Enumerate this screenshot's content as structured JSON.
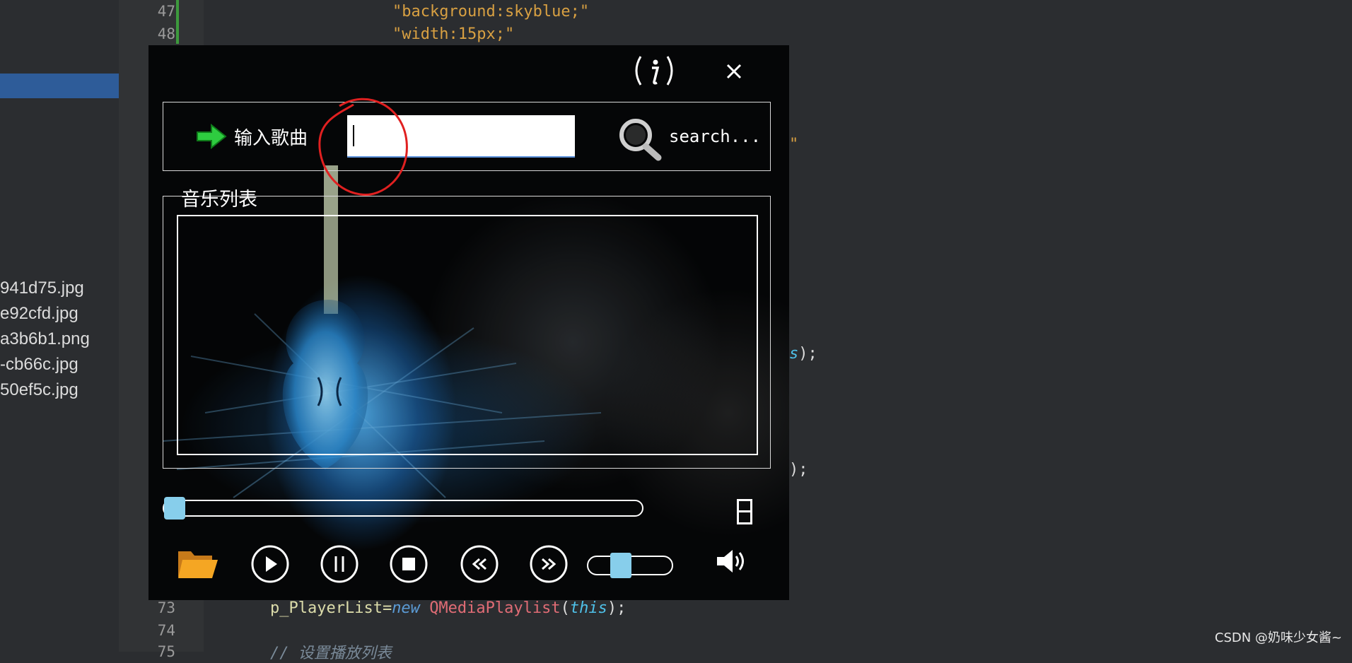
{
  "ide": {
    "files": [
      "941d75.jpg",
      "e92cfd.jpg",
      "a3b6b1.png",
      "-cb66c.jpg",
      "50ef5c.jpg"
    ],
    "line_numbers": {
      "l47": "47",
      "l48": "48",
      "l73": "73",
      "l74": "74",
      "l75": "75"
    },
    "code": {
      "l47": "\"background:skyblue;\"",
      "l48": "\"width:15px;\"",
      "frag_quote": "\"",
      "frag_s_name": "s",
      "frag_s_end": ");",
      "frag_paren": ");",
      "l73_var": "p_PlayerList=",
      "l73_new": "new",
      "l73_class": "QMediaPlaylist",
      "l73_open": "(",
      "l73_this": "this",
      "l73_close": ");",
      "l75_comment": "// 设置播放列表"
    }
  },
  "player": {
    "info_icon_glyph": "(𝑖)",
    "close_icon_glyph": "×",
    "input_label": "输入歌曲",
    "song_input_value": "",
    "search_label": "search...",
    "playlist_title": "音乐列表",
    "progress_fraction": 0.0,
    "volume_fraction": 0.35
  },
  "colors": {
    "accent_handle": "#87ceeb",
    "input_underline": "#5a8fd8",
    "annotation_red": "#e02020",
    "folder_orange": "#f0a020"
  },
  "watermark": "CSDN @奶味少女酱~"
}
